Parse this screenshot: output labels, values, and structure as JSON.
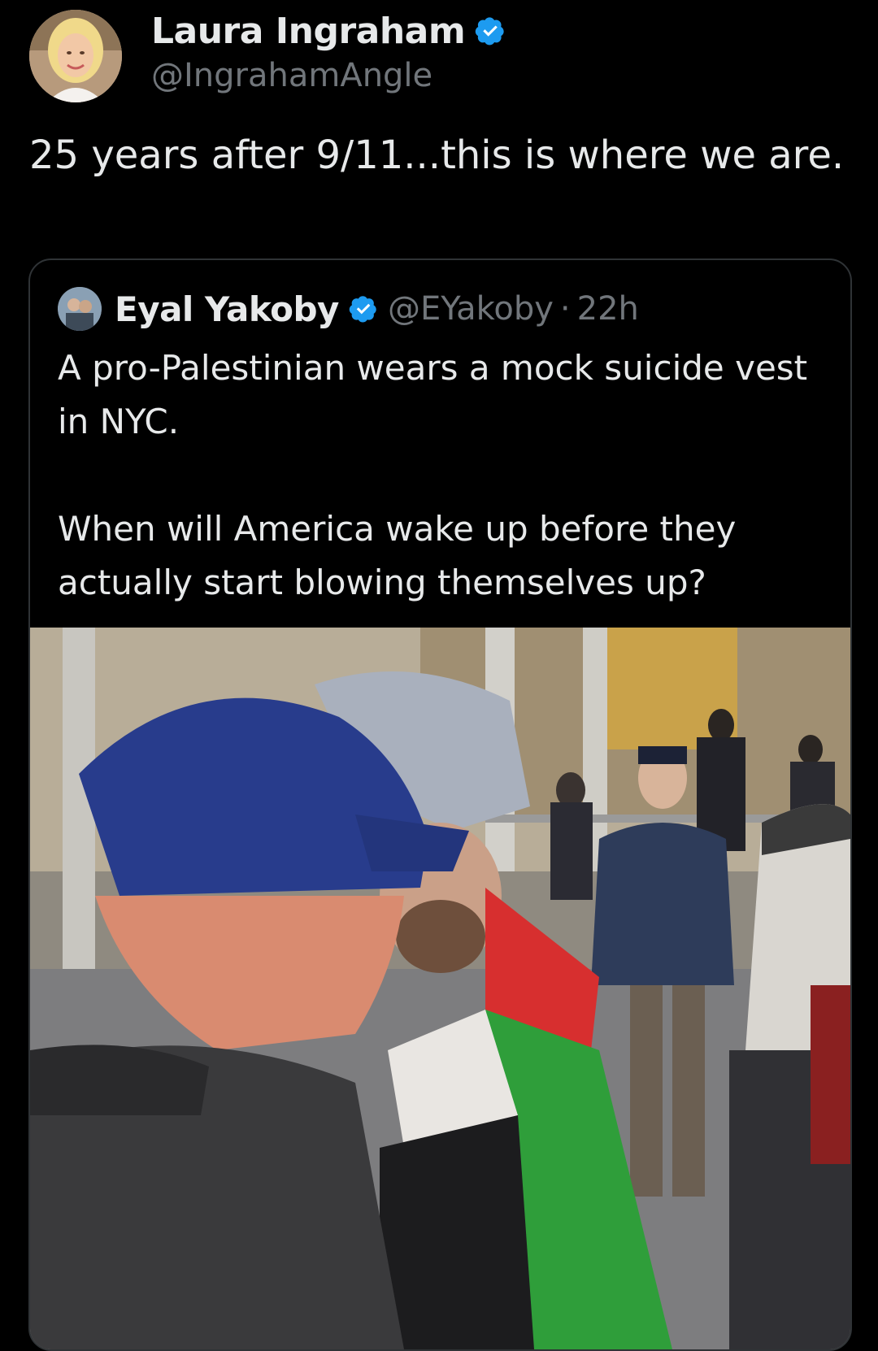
{
  "tweet": {
    "author": {
      "name": "Laura Ingraham",
      "handle": "@IngrahamAngle",
      "verified": true,
      "verified_color": "#1d9bf0"
    },
    "text": "25 years after 9/11...this is where we are."
  },
  "quoted_tweet": {
    "author": {
      "name": "Eyal Yakoby",
      "handle": "@EYakoby",
      "verified": true
    },
    "separator": "·",
    "time": "22h",
    "text_paragraphs": [
      "A pro-Palestinian wears a mock suicide vest in NYC.",
      "When will America wake up before they actually start blowing themselves up?"
    ],
    "media": {
      "type": "video-still",
      "description_icon": "photo"
    }
  },
  "colors": {
    "background": "#000000",
    "text_primary": "#e7e9ea",
    "text_secondary": "#71767b",
    "border": "#2f3336",
    "accent": "#1d9bf0"
  }
}
